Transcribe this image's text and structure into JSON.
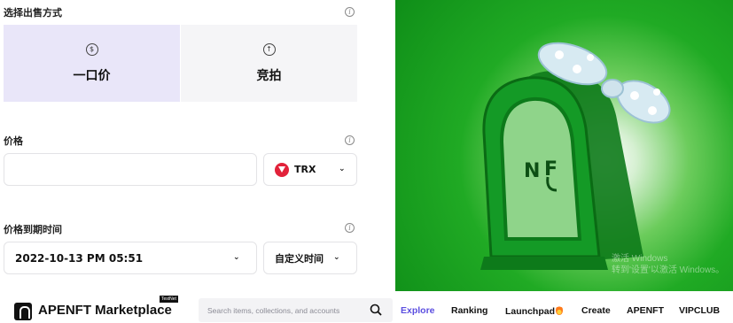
{
  "sell_method": {
    "label": "选择出售方式",
    "options": [
      {
        "icon": "dollar-icon",
        "glyph": "$",
        "label": "一口价",
        "selected": true
      },
      {
        "icon": "arrow-up-icon",
        "glyph": "↑",
        "label": "竞拍",
        "selected": false
      }
    ]
  },
  "price": {
    "label": "价格",
    "value": "",
    "currency": "TRX"
  },
  "expiry": {
    "label": "价格到期时间",
    "value": "2022-10-13 PM 05:51",
    "mode": "自定义时间"
  },
  "info_glyph": "i",
  "chevron_glyph": "⌄",
  "watermark": {
    "line1": "激活 Windows",
    "line2": "转到'设置'以激活 Windows。"
  },
  "nav": {
    "brand": "APENFT Marketplace",
    "badge": "TestNet",
    "search_placeholder": "Search items, collections, and accounts",
    "links": [
      "Explore",
      "Ranking",
      "Launchpad",
      "Create",
      "APENFT",
      "VIPCLUB"
    ],
    "active": "Explore"
  },
  "colors": {
    "accent": "#5b4ee0",
    "selected_tab": "#e9e6f9",
    "art_green": "#1a9e22",
    "trx_red": "#e2223a"
  }
}
